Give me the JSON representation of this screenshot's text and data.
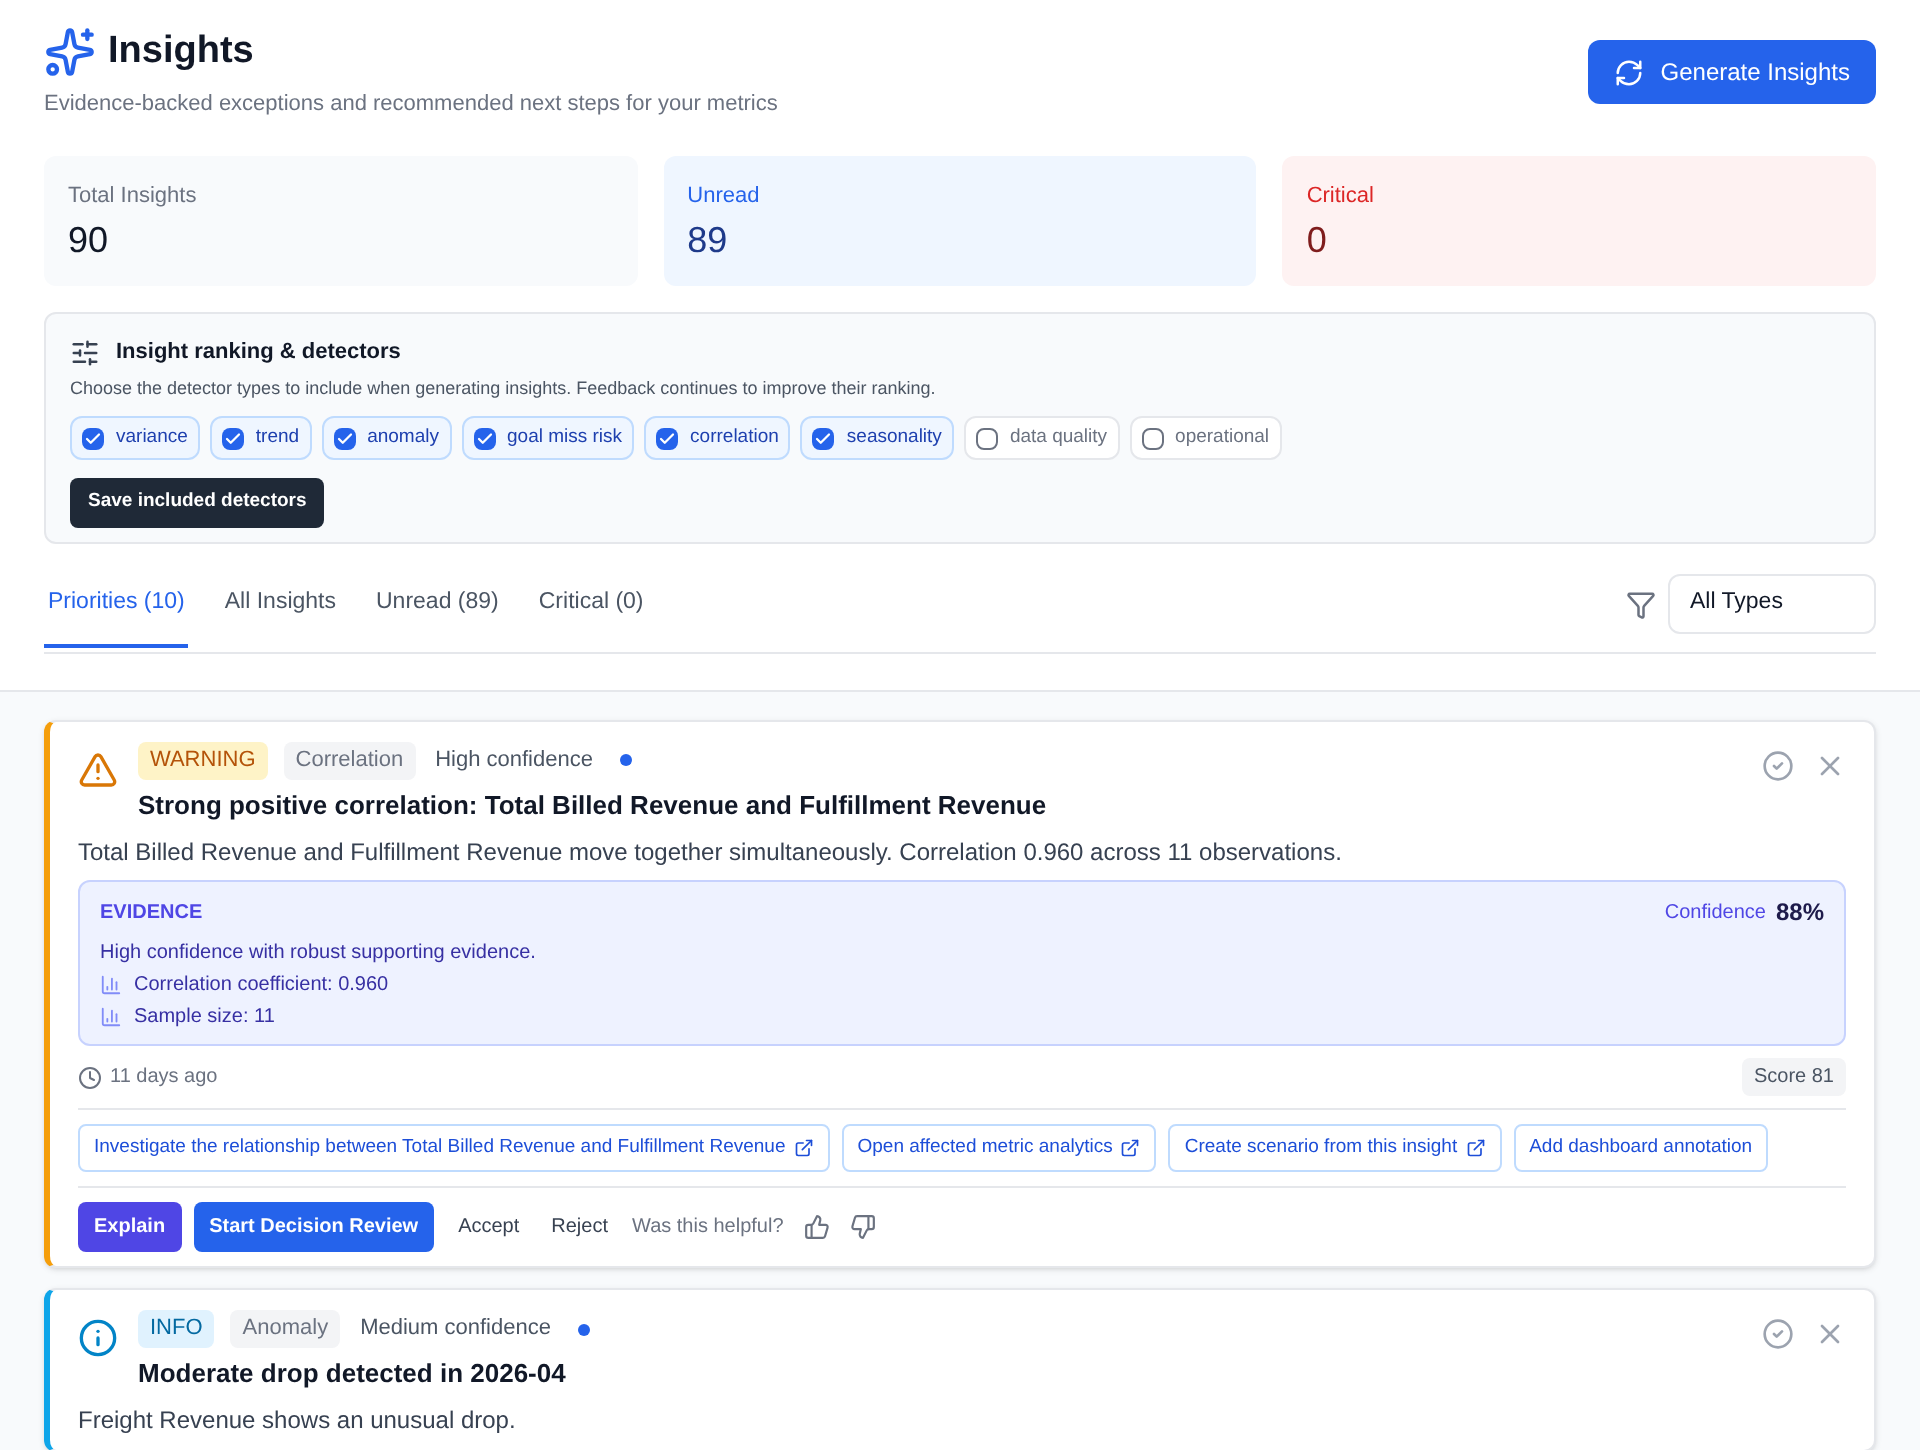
{
  "header": {
    "title": "Insights",
    "subtitle": "Evidence-backed exceptions and recommended next steps for your metrics",
    "generate_button": "Generate Insights"
  },
  "stats": [
    {
      "label": "Total Insights",
      "value": "90",
      "kind": "neutral"
    },
    {
      "label": "Unread",
      "value": "89",
      "kind": "info"
    },
    {
      "label": "Critical",
      "value": "0",
      "kind": "critical"
    }
  ],
  "detectors": {
    "title": "Insight ranking & detectors",
    "description": "Choose the detector types to include when generating insights. Feedback continues to improve their ranking.",
    "options": [
      {
        "label": "variance",
        "checked": true
      },
      {
        "label": "trend",
        "checked": true
      },
      {
        "label": "anomaly",
        "checked": true
      },
      {
        "label": "goal miss risk",
        "checked": true
      },
      {
        "label": "correlation",
        "checked": true
      },
      {
        "label": "seasonality",
        "checked": true
      },
      {
        "label": "data quality",
        "checked": false
      },
      {
        "label": "operational",
        "checked": false
      }
    ],
    "save_button": "Save included detectors"
  },
  "tabs": [
    {
      "label": "Priorities (10)",
      "selected": true
    },
    {
      "label": "All Insights",
      "selected": false
    },
    {
      "label": "Unread (89)",
      "selected": false
    },
    {
      "label": "Critical (0)",
      "selected": false
    }
  ],
  "type_filter": {
    "value": "All Types"
  },
  "insights": [
    {
      "kind": "warning",
      "severity_label": "WARNING",
      "category": "Correlation",
      "confidence": "High confidence",
      "unread": true,
      "title": "Strong positive correlation: Total Billed Revenue and Fulfillment Revenue",
      "description": "Total Billed Revenue and Fulfillment Revenue move together simultaneously. Correlation 0.960 across 11 observations.",
      "evidence": {
        "heading": "EVIDENCE",
        "confidence_label": "Confidence",
        "confidence_value": "88%",
        "summary": "High confidence with robust supporting evidence.",
        "facts": [
          "Correlation coefficient: 0.960",
          "Sample size: 11"
        ]
      },
      "time": "11 days ago",
      "score": "Score 81",
      "actions": [
        {
          "label": "Investigate the relationship between Total Billed Revenue and Fulfillment Revenue",
          "external": true
        },
        {
          "label": "Open affected metric analytics",
          "external": true
        },
        {
          "label": "Create scenario from this insight",
          "external": true
        },
        {
          "label": "Add dashboard annotation",
          "external": false
        }
      ],
      "explain_button": "Explain",
      "review_button": "Start Decision Review",
      "accept_button": "Accept",
      "reject_button": "Reject",
      "helpful_prompt": "Was this helpful?"
    },
    {
      "kind": "info",
      "severity_label": "INFO",
      "category": "Anomaly",
      "confidence": "Medium confidence",
      "unread": true,
      "title": "Moderate drop detected in 2026-04",
      "description": "Freight Revenue shows an unusual drop."
    }
  ]
}
